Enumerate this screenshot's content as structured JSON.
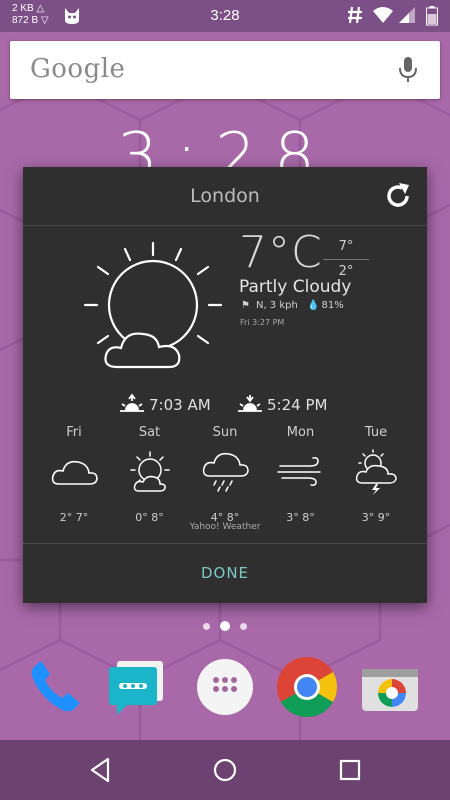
{
  "status_bar": {
    "net_up": "2 KB",
    "net_down": "872 B",
    "time": "3:28",
    "icons": [
      "cat-icon",
      "hash-icon",
      "wifi-icon",
      "signal-icon",
      "battery-icon"
    ]
  },
  "search": {
    "logo_text": "Google",
    "icons": [
      "mic-icon"
    ]
  },
  "home_clock": "3:28",
  "weather": {
    "location": "London",
    "temperature": "7°C",
    "high": "7°",
    "low": "2°",
    "condition": "Partly Cloudy",
    "wind": "N, 3 kph",
    "humidity": "81%",
    "updated": "Fri 3:27 PM",
    "sunrise": "7:03 AM",
    "sunset": "5:24 PM",
    "forecast": [
      {
        "day": "Fri",
        "range": "2° 7°",
        "icon": "cloud-icon"
      },
      {
        "day": "Sat",
        "range": "0° 8°",
        "icon": "partly-sunny-icon"
      },
      {
        "day": "Sun",
        "range": "4° 8°",
        "icon": "rain-cloud-icon"
      },
      {
        "day": "Mon",
        "range": "3° 8°",
        "icon": "wind-icon"
      },
      {
        "day": "Tue",
        "range": "3° 9°",
        "icon": "storm-icon"
      }
    ],
    "source": "Yahoo! Weather",
    "done_label": "DONE"
  },
  "dock": [
    "phone-app",
    "messenger-app",
    "app-drawer",
    "chrome-app",
    "camera-app"
  ],
  "colors": {
    "status_bar": "#7c4f86",
    "wallpaper": "#a969a9",
    "dialog_bg": "#2f2f2f",
    "accent": "#7ec8c0",
    "nav_bar": "#6c4370"
  }
}
